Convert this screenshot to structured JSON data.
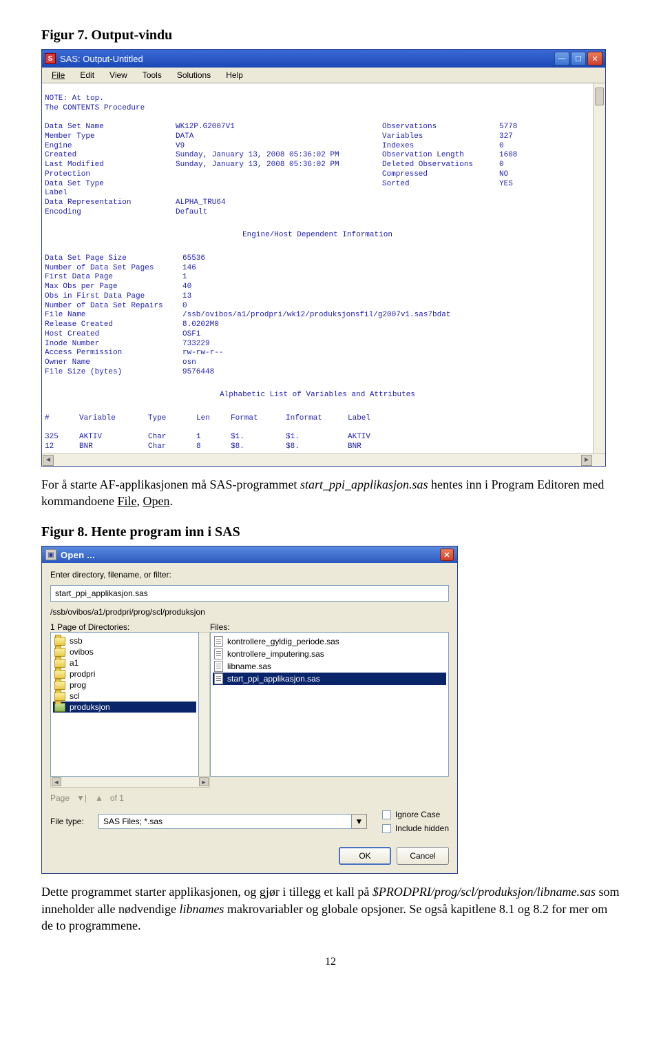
{
  "fig7": {
    "title": "Figur 7. Output-vindu"
  },
  "sas_window": {
    "title": "SAS: Output-Untitled",
    "menu": [
      "File",
      "Edit",
      "View",
      "Tools",
      "Solutions",
      "Help"
    ],
    "note1": "NOTE: At top.",
    "note2": "The CONTENTS Procedure",
    "block1": [
      {
        "l": "Data Set Name",
        "v": "WK12P.G2007V1",
        "r": "Observations",
        "rv": "5778"
      },
      {
        "l": "Member Type",
        "v": "DATA",
        "r": "Variables",
        "rv": "327"
      },
      {
        "l": "Engine",
        "v": "V9",
        "r": "Indexes",
        "rv": "0"
      },
      {
        "l": "Created",
        "v": "Sunday, January 13, 2008 05:36:02 PM",
        "r": "Observation Length",
        "rv": "1608"
      },
      {
        "l": "Last Modified",
        "v": "Sunday, January 13, 2008 05:36:02 PM",
        "r": "Deleted Observations",
        "rv": "0"
      },
      {
        "l": "Protection",
        "v": "",
        "r": "Compressed",
        "rv": "NO"
      },
      {
        "l": "Data Set Type",
        "v": "",
        "r": "Sorted",
        "rv": "YES"
      },
      {
        "l": "Label",
        "v": "",
        "r": "",
        "rv": ""
      },
      {
        "l": "Data Representation",
        "v": "ALPHA_TRU64",
        "r": "",
        "rv": ""
      },
      {
        "l": "Encoding",
        "v": "Default",
        "r": "",
        "rv": ""
      }
    ],
    "section2_title": "Engine/Host Dependent Information",
    "block2": [
      {
        "l": "Data Set Page Size",
        "v": "65536"
      },
      {
        "l": "Number of Data Set Pages",
        "v": "146"
      },
      {
        "l": "First Data Page",
        "v": "1"
      },
      {
        "l": "Max Obs per Page",
        "v": "40"
      },
      {
        "l": "Obs in First Data Page",
        "v": "13"
      },
      {
        "l": "Number of Data Set Repairs",
        "v": "0"
      },
      {
        "l": "File Name",
        "v": "/ssb/ovibos/a1/prodpri/wk12/produksjonsfil/g2007v1.sas7bdat"
      },
      {
        "l": "Release Created",
        "v": "8.0202M0"
      },
      {
        "l": "Host Created",
        "v": "OSF1"
      },
      {
        "l": "Inode Number",
        "v": "733229"
      },
      {
        "l": "Access Permission",
        "v": "rw-rw-r--"
      },
      {
        "l": "Owner Name",
        "v": "osn"
      },
      {
        "l": "File Size (bytes)",
        "v": "9576448"
      }
    ],
    "section3_title": "Alphabetic List of Variables and Attributes",
    "var_head": {
      "c1": "#",
      "c2": "Variable",
      "c3": "Type",
      "c4": "Len",
      "c5": "Format",
      "c6": "Informat",
      "c7": "Label"
    },
    "vars": [
      {
        "c1": "325",
        "c2": "AKTIV",
        "c3": "Char",
        "c4": "1",
        "c5": "$1.",
        "c6": "$1.",
        "c7": "AKTIV"
      },
      {
        "c1": "12",
        "c2": "BNR",
        "c3": "Char",
        "c4": "8",
        "c5": "$8.",
        "c6": "$8.",
        "c7": "BNR"
      }
    ]
  },
  "para1": {
    "t1": "For å starte AF-applikasjonen må SAS-programmet ",
    "i1": "start_ppi_applikasjon.sas",
    "t2": " hentes inn i Program Editoren med kommandoene ",
    "u1": "File",
    "t3": ", ",
    "u2": "Open",
    "t4": "."
  },
  "fig8": {
    "title": "Figur 8. Hente program inn i SAS"
  },
  "open_dialog": {
    "title": "Open ...",
    "prompt": "Enter directory, filename, or filter:",
    "input_value": "start_ppi_applikasjon.sas",
    "path": "/ssb/ovibos/a1/prodpri/prog/scl/produksjon",
    "dir_header": "1 Page of Directories:",
    "files_header": "Files:",
    "dirs": [
      "ssb",
      "ovibos",
      "a1",
      "prodpri",
      "prog",
      "scl",
      "produksjon"
    ],
    "files": [
      "kontrollere_gyldig_periode.sas",
      "kontrollere_imputering.sas",
      "libname.sas",
      "start_ppi_applikasjon.sas"
    ],
    "page_label": "Page",
    "of_label": "of 1",
    "filetype_label": "File type:",
    "filetype_value": "SAS Files; *.sas",
    "ignore_case": "Ignore Case",
    "include_hidden": "Include hidden",
    "ok": "OK",
    "cancel": "Cancel"
  },
  "para2": {
    "t1": "Dette programmet starter applikasjonen, og gjør i tillegg et kall på ",
    "i1": "$PRODPRI/prog/scl/produksjon/libname.sas",
    "t2": " som inneholder alle nødvendige ",
    "i2": "libnames",
    "t3": " makrovariabler og globale opsjoner. Se også kapitlene 8.1 og 8.2 for mer om de to programmene."
  },
  "page_number": "12"
}
